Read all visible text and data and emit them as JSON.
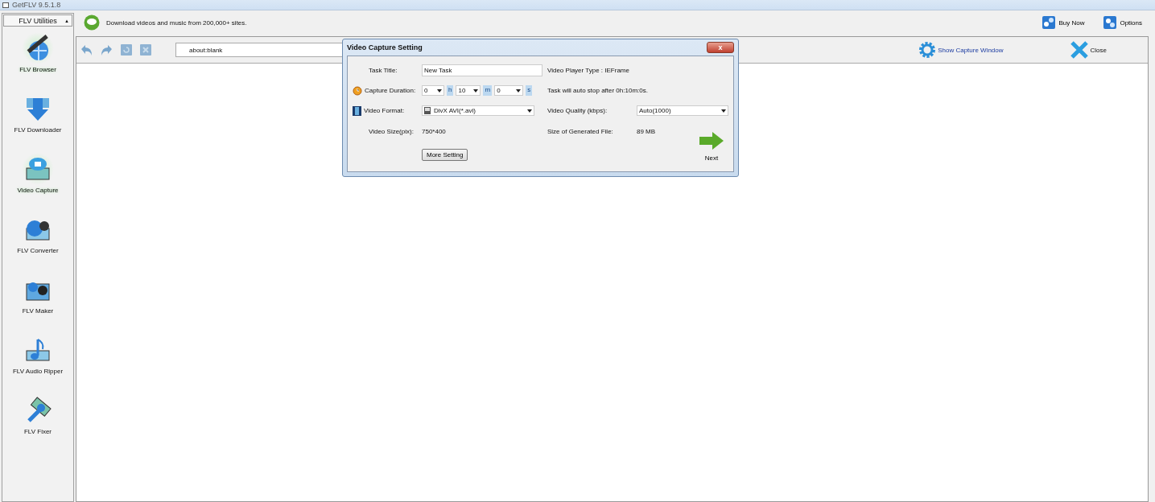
{
  "window": {
    "title": "GetFLV 9.5.1.8"
  },
  "sidebar": {
    "header": "FLV Utilities",
    "header_arrow": "▲",
    "items": [
      {
        "label": "FLV Browser",
        "selected": true
      },
      {
        "label": "FLV Downloader",
        "selected": false
      },
      {
        "label": "Video Capture",
        "selected": true
      },
      {
        "label": "FLV Converter",
        "selected": false
      },
      {
        "label": "FLV Maker",
        "selected": false
      },
      {
        "label": "FLV Audio Ripper",
        "selected": false
      },
      {
        "label": "FLV Fixer",
        "selected": false
      }
    ]
  },
  "header": {
    "message": "Download videos and music from 200,000+ sites.",
    "buttons": [
      "Buy Now",
      "Options"
    ]
  },
  "toolbar": {
    "address": "about:blank",
    "show_capture": "Show Capture Window",
    "close": "Close"
  },
  "dialog": {
    "title": "Video Capture Setting",
    "close": "x",
    "task_title_label": "Task Title:",
    "task_title": "New Task",
    "player_type": "Video Player Type : IEFrame",
    "duration_label": "Capture Duration:",
    "duration": [
      {
        "value": "0",
        "unit": "h"
      },
      {
        "value": "10",
        "unit": "m"
      },
      {
        "value": "0",
        "unit": "s"
      }
    ],
    "auto_stop": "Task will auto stop after 0h:10m:0s.",
    "format_label": "Video Format:",
    "format": "DivX AVI(*.avi)",
    "quality_label": "Video Quality (kbps):",
    "quality": "Auto(1000)",
    "size_label": "Video Size(pix):",
    "size": "750*400",
    "file_size_label": "Size of Generated File:",
    "file_size": "89 MB",
    "more_button": "More Setting",
    "next": "Next"
  }
}
